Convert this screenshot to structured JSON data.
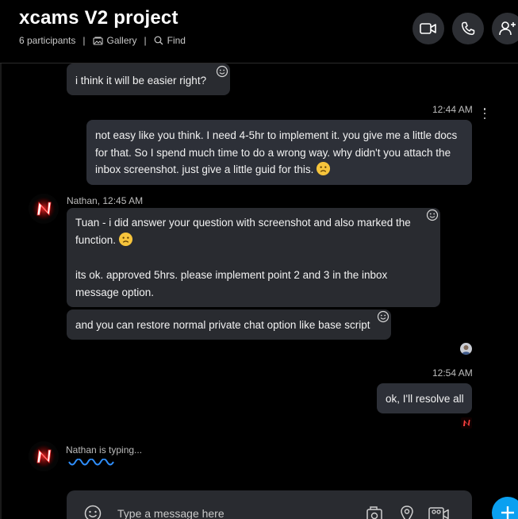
{
  "header": {
    "title": "xcams V2 project",
    "participants": "6 participants",
    "gallery_label": "Gallery",
    "find_label": "Find",
    "separator": "|"
  },
  "messages": [
    {
      "type": "in",
      "text": "i think it  will be easier right?"
    },
    {
      "type": "out",
      "time": "12:44 AM",
      "text": "not easy like you think. I need 4-5hr to implement it. you give me a little docs for that. So I spend much time to do a wrong way. why didn't you attach the inbox screenshot. just give a little guid for this."
    },
    {
      "type": "in",
      "sender": "Nathan, 12:45 AM",
      "text_a": "Tuan - i did answer your question with screenshot and also marked the function.",
      "text_b": "its ok. approved 5hrs. please implement point 2 and 3 in the inbox message option."
    },
    {
      "type": "in",
      "text": "and you can restore normal private chat option like base script"
    },
    {
      "type": "out",
      "time": "12:54 AM",
      "text": "ok, I'll resolve all"
    }
  ],
  "typing": {
    "text": "Nathan is typing..."
  },
  "composer": {
    "placeholder": "Type a message here"
  },
  "colors": {
    "accent": "#0aa0f0",
    "typing_wave": "#2f8fff",
    "bubble": "#292b30",
    "background": "#000000"
  },
  "icons": [
    "video-call-icon",
    "phone-call-icon",
    "add-person-icon",
    "gallery-icon",
    "search-icon",
    "emoji-icon",
    "more-options-icon",
    "sad-emoji-icon",
    "media-icon",
    "location-icon",
    "video-message-icon",
    "plus-icon"
  ]
}
